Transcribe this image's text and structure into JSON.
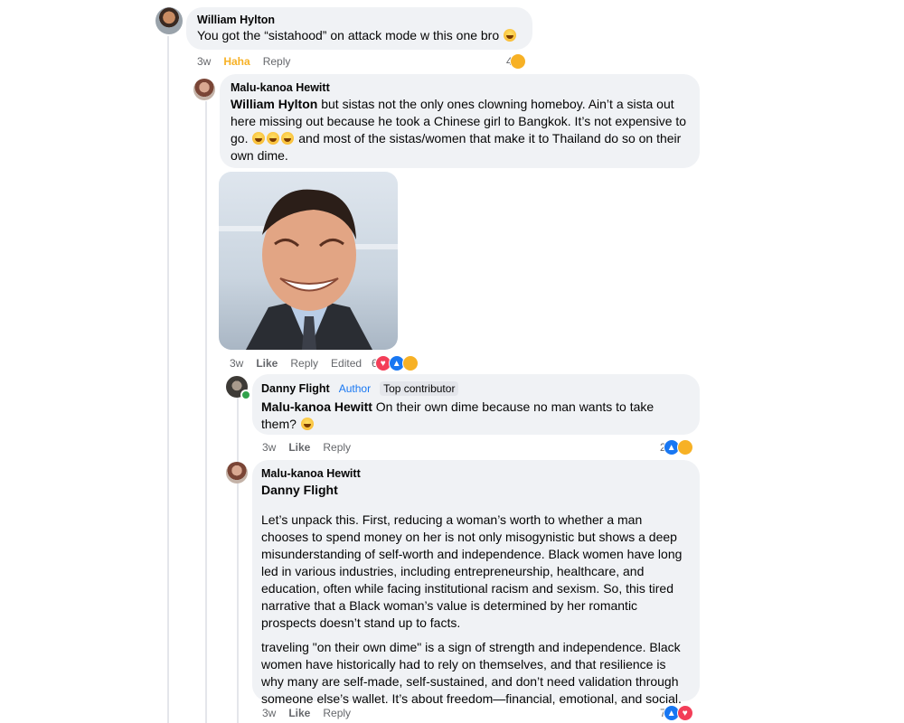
{
  "comments": {
    "william": {
      "author": "William Hylton",
      "text": "You got the “sistahood” on attack mode w this one bro",
      "time": "3w",
      "reaction_label": "Haha",
      "reply": "Reply",
      "reaction_count": "4"
    },
    "malu1": {
      "author": "Malu-kanoa Hewitt",
      "mention": "William Hylton",
      "text_a": "but sistas not the only ones clowning homeboy. Ain’t a sista out here missing out because he took a Chinese girl to Bangkok. It’s not expensive to go.",
      "text_b": "and most of the sistas/women that make it to Thailand do so on their own dime.",
      "time": "3w",
      "like": "Like",
      "reply": "Reply",
      "edited": "Edited",
      "reaction_count": "6"
    },
    "danny": {
      "author": "Danny Flight",
      "badge_author": "Author",
      "badge_top": "Top contributor",
      "mention": "Malu-kanoa Hewitt",
      "text": "On their own dime because no man wants to take them?",
      "time": "3w",
      "like": "Like",
      "reply": "Reply",
      "reaction_count": "2"
    },
    "malu2": {
      "author": "Malu-kanoa Hewitt",
      "mention": "Danny Flight",
      "para1": "Let’s unpack this. First, reducing a woman’s worth to whether a man chooses to spend money on her is not only misogynistic but shows a deep misunderstanding of self-worth and independence. Black women have long led in various industries, including entrepreneurship, healthcare, and education, often while facing institutional racism and sexism. So, this tired narrative that a Black woman’s value is determined by her romantic prospects doesn’t stand up to facts.",
      "para2": "traveling \"on their own dime\" is a sign of strength and independence. Black women have historically had to rely on themselves, and that resilience is why many are self-made, self-sustained, and don’t need validation through someone else’s wallet. It’s about freedom—financial, emotional, and social.",
      "time": "3w",
      "like": "Like",
      "reply": "Reply",
      "reaction_count": "7"
    }
  },
  "colors": {
    "bubble": "#f0f2f5",
    "meta": "#65676b",
    "haha": "#f7b125",
    "like": "#1877f2",
    "love": "#f33e58"
  },
  "icons": [
    "laughing-emoji-icon",
    "like-reaction-icon",
    "love-reaction-icon",
    "haha-reaction-icon",
    "sad-reaction-icon",
    "smirk-emoji-icon",
    "online-status-dot"
  ]
}
